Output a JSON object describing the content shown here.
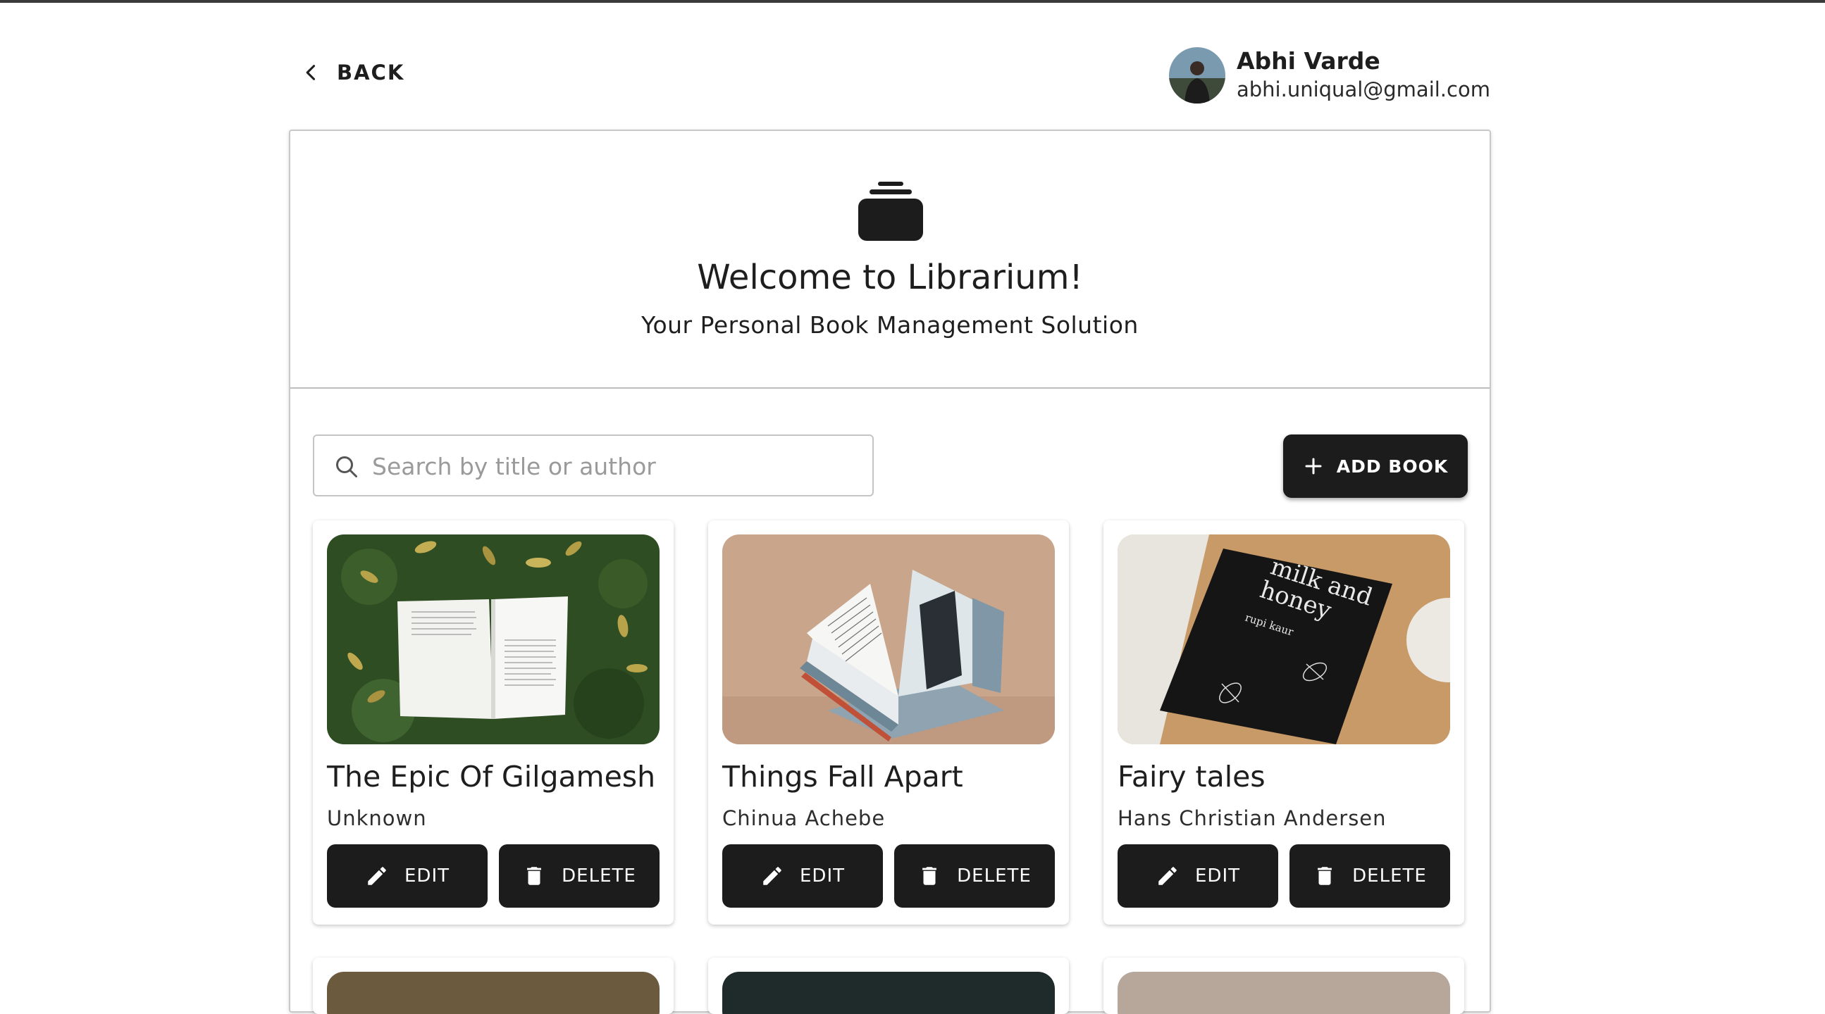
{
  "header": {
    "back_label": "BACK",
    "user": {
      "name": "Abhi Varde",
      "email": "abhi.uniqual@gmail.com"
    }
  },
  "hero": {
    "icon": "stacked-archive-icon",
    "title": "Welcome to Librarium!",
    "subtitle": "Your Personal Book Management Solution"
  },
  "toolbar": {
    "search_placeholder": "Search by title or author",
    "add_label": "ADD BOOK"
  },
  "books": [
    {
      "title": "The Epic Of Gilgamesh",
      "author": "Unknown",
      "edit_label": "EDIT",
      "delete_label": "DELETE"
    },
    {
      "title": "Things Fall Apart",
      "author": "Chinua Achebe",
      "edit_label": "EDIT",
      "delete_label": "DELETE"
    },
    {
      "title": "Fairy tales",
      "author": "Hans Christian Andersen",
      "edit_label": "EDIT",
      "delete_label": "DELETE"
    }
  ],
  "cover_art": {
    "book3_text_line1": "milk and",
    "book3_text_line2": "honey",
    "book3_text_author": "rupi kaur"
  },
  "colors": {
    "accent": "#1c1c1c",
    "background": "#ffffff",
    "border": "#c8c8c8"
  }
}
